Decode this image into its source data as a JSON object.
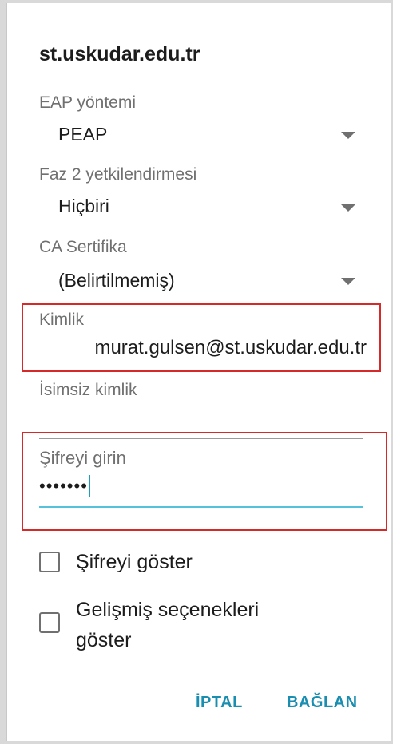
{
  "dialog": {
    "title": "st.uskudar.edu.tr",
    "eap_method": {
      "label": "EAP yöntemi",
      "value": "PEAP"
    },
    "phase2_auth": {
      "label": "Faz 2 yetkilendirmesi",
      "value": "Hiçbiri"
    },
    "ca_certificate": {
      "label": "CA Sertifika",
      "value": "(Belirtilmemiş)"
    },
    "identity": {
      "label": "Kimlik",
      "value": "murat.gulsen@st.uskudar.edu.tr"
    },
    "anonymous_identity": {
      "label": "İsimsiz kimlik"
    },
    "password": {
      "label": "Şifreyi girin",
      "value": "•••••••"
    },
    "show_password": {
      "label": "Şifreyi göster",
      "checked": false
    },
    "advanced_options": {
      "label_line1": "Gelişmiş seçenekleri",
      "label_line2": "göster",
      "checked": false
    },
    "buttons": {
      "cancel": "İPTAL",
      "connect": "BAĞLAN"
    }
  },
  "colors": {
    "accent": "#1a8eb0",
    "input_focus": "#56c1db",
    "highlight_box": "#d62a2a"
  }
}
